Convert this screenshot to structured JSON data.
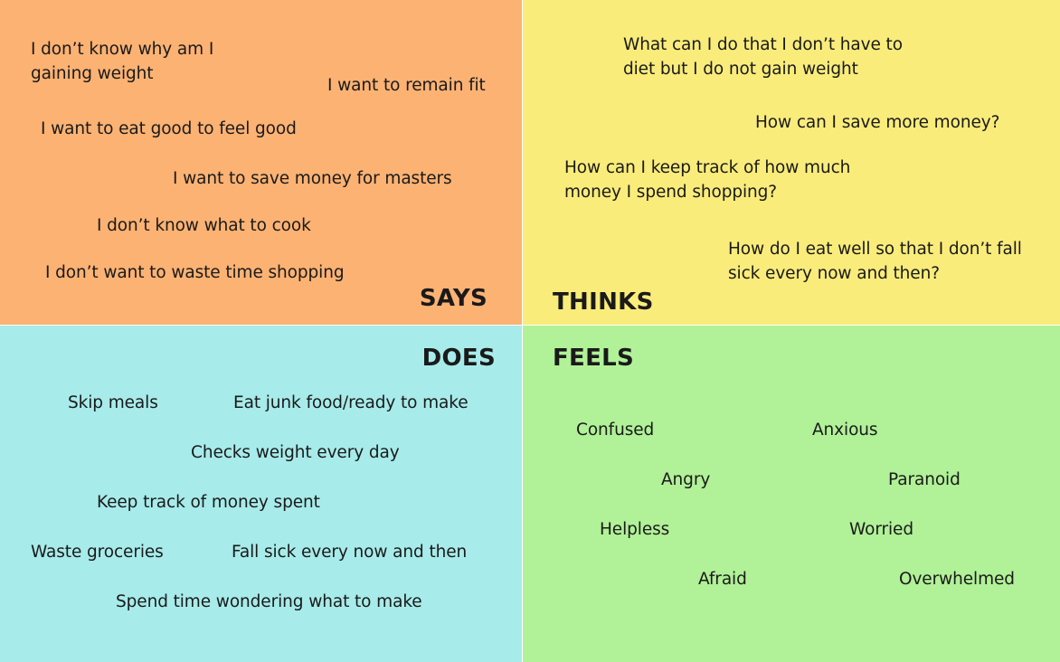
{
  "colors": {
    "says_bg": "#fbb273",
    "thinks_bg": "#f9ec7a",
    "does_bg": "#a7ebea",
    "feels_bg": "#b1f198",
    "divider": "#ffffff",
    "text": "#1a1a1a"
  },
  "says": {
    "heading": "SAYS",
    "items": [
      "I don’t know why am I\ngaining weight",
      "I want to remain fit",
      "I want to eat good to feel good",
      "I want to save money for masters",
      "I don’t know what to cook",
      "I don’t want to waste time shopping"
    ]
  },
  "thinks": {
    "heading": "THINKS",
    "items": [
      "What can I do that I don’t have to\ndiet but I do not gain weight",
      "How can I save more money?",
      "How can I keep track of how much\nmoney I spend shopping?",
      "How do I eat well so that I don’t fall\nsick every now and then?"
    ]
  },
  "does": {
    "heading": "DOES",
    "items": [
      "Skip meals",
      "Eat junk food/ready to make",
      "Checks weight every day",
      "Keep track of money spent",
      "Waste groceries",
      "Fall sick every now and then",
      "Spend time wondering what to make"
    ]
  },
  "feels": {
    "heading": "FEELS",
    "items": [
      "Confused",
      "Anxious",
      "Angry",
      "Paranoid",
      "Helpless",
      "Worried",
      "Afraid",
      "Overwhelmed"
    ]
  }
}
